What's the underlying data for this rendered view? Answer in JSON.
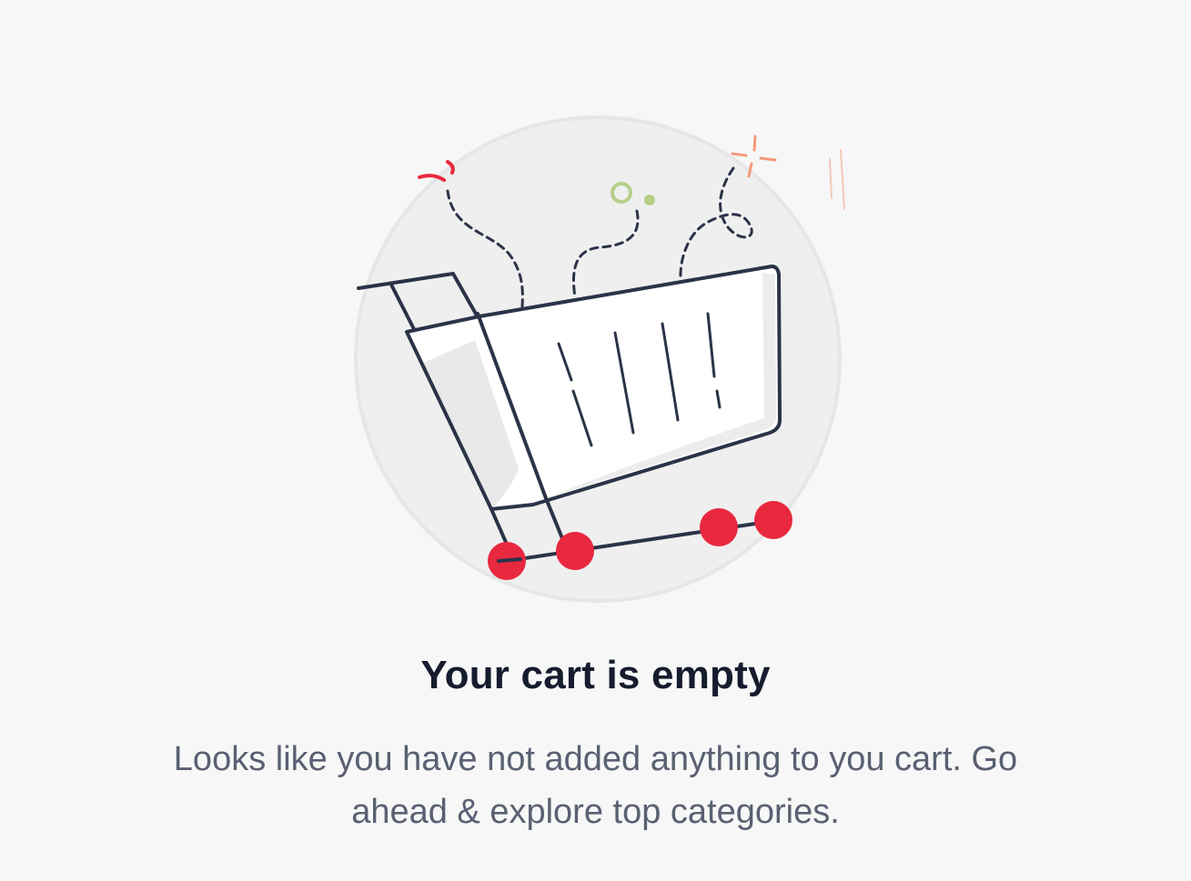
{
  "empty_cart": {
    "illustration_icon": "empty-shopping-cart-icon",
    "title": "Your cart is empty",
    "message": "Looks like you have not added anything to you cart. Go ahead & explore top categories."
  },
  "colors": {
    "background": "#f7f7f7",
    "circle": "#efefef",
    "cart_outline": "#2b3348",
    "wheels": "#e8283f",
    "title_text": "#161b2e",
    "message_text": "#5a6072",
    "accent_green": "#b5cf8a",
    "accent_orange": "#f59a7c"
  }
}
